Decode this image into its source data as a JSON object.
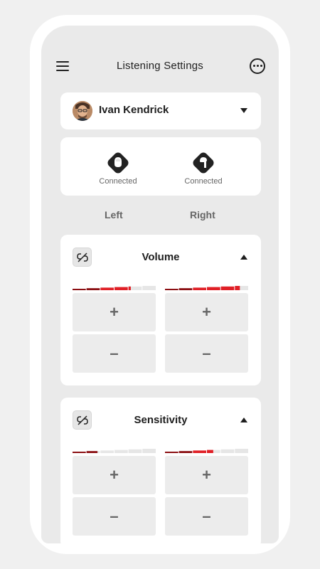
{
  "header": {
    "title": "Listening Settings",
    "menu_icon": "hamburger-menu-icon",
    "more_icon": "more-options-icon"
  },
  "user": {
    "name": "Ivan Kendrick",
    "avatar_icon": "avatar",
    "dropdown_icon": "caret-down-icon"
  },
  "devices": [
    {
      "side": "left",
      "status": "Connected",
      "icon": "left-earbud-icon"
    },
    {
      "side": "right",
      "status": "Connected",
      "icon": "right-earbud-icon"
    }
  ],
  "ear_labels": {
    "left": "Left",
    "right": "Right"
  },
  "controls": [
    {
      "title": "Volume",
      "link_icon": "unlink-icon",
      "collapse_icon": "caret-up-icon",
      "left_level": 0.7,
      "right_level": 0.9,
      "increase": "+",
      "decrease": "–"
    },
    {
      "title": "Sensitivity",
      "link_icon": "unlink-icon",
      "collapse_icon": "caret-up-icon",
      "left_level": 0.3,
      "right_level": 0.58,
      "increase": "+",
      "decrease": "–"
    }
  ],
  "colors": {
    "accent": "#e01f26",
    "accent_dark": "#8b0f13",
    "track": "#e6e6e6",
    "card": "#ffffff",
    "background": "#eaeaea"
  }
}
